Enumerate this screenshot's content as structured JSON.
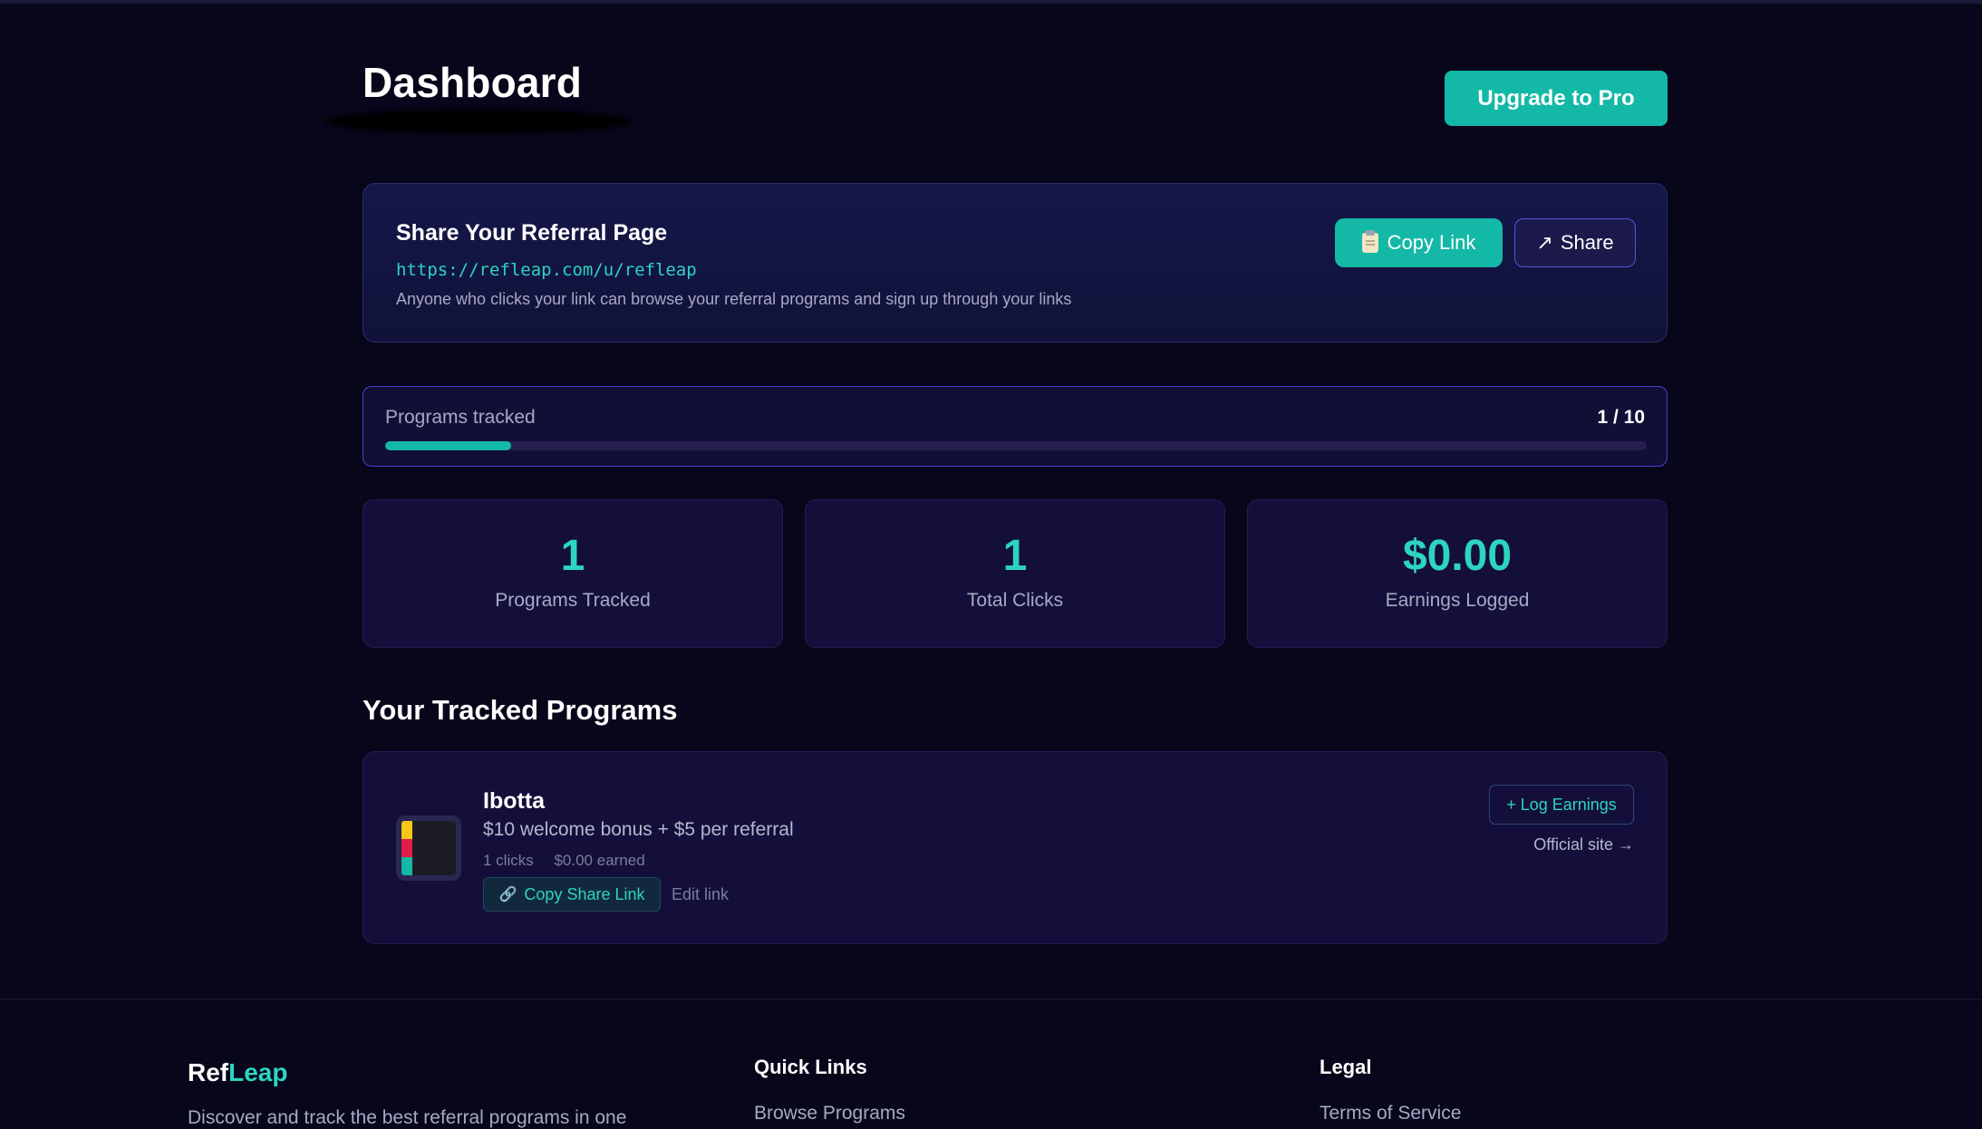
{
  "header": {
    "title": "Dashboard",
    "upgrade_label": "Upgrade to Pro"
  },
  "share": {
    "title": "Share Your Referral Page",
    "url": "https://refleap.com/u/refleap",
    "description": "Anyone who clicks your link can browse your referral programs and sign up through your links",
    "copy_label": "Copy Link",
    "share_label": "Share",
    "copy_icon": "clipboard-icon",
    "share_icon": "arrow-up-right-icon"
  },
  "progress": {
    "label": "Programs tracked",
    "count_text": "1 / 10",
    "fraction": 0.1
  },
  "stats": [
    {
      "value": "1",
      "label": "Programs Tracked"
    },
    {
      "value": "1",
      "label": "Total Clicks"
    },
    {
      "value": "$0.00",
      "label": "Earnings Logged"
    }
  ],
  "programs_section": {
    "title": "Your Tracked Programs",
    "items": [
      {
        "name": "Ibotta",
        "description": "$10 welcome bonus + $5 per referral",
        "clicks": "1 clicks",
        "earned": "$0.00 earned",
        "copy_share_label": "Copy Share Link",
        "edit_label": "Edit link",
        "log_earnings_label": "+ Log Earnings",
        "official_site_label": "Official site →",
        "logo_colors": [
          "#f5c518",
          "#e11d48",
          "#14b8a6"
        ]
      }
    ]
  },
  "footer": {
    "brand_part1": "Ref",
    "brand_part2": "Leap",
    "description": "Discover and track the best referral programs in one",
    "quick_links_heading": "Quick Links",
    "quick_links": [
      "Browse Programs"
    ],
    "legal_heading": "Legal",
    "legal_links": [
      "Terms of Service"
    ]
  },
  "colors": {
    "background": "#07061a",
    "accent": "#14b8a6",
    "accent_text": "#2dd4bf",
    "card": "#140f3a",
    "progress_border": "#4b3fd1"
  }
}
